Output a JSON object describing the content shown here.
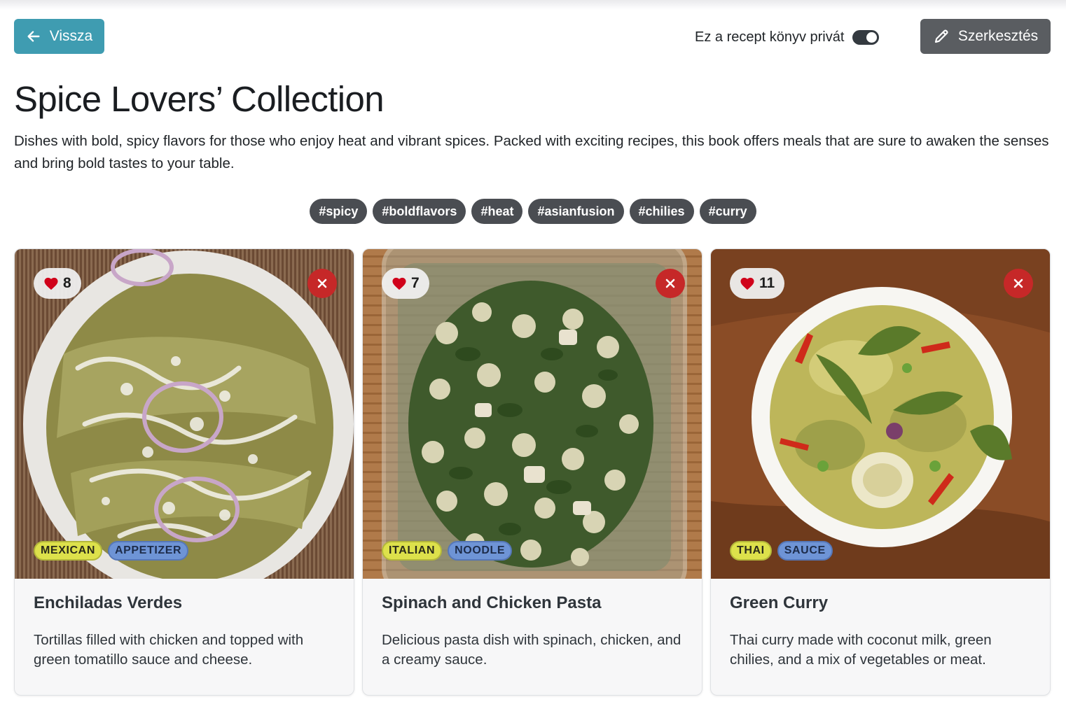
{
  "header": {
    "back_label": "Vissza",
    "privacy_label": "Ez a recept könyv privát",
    "privacy_on": true,
    "edit_label": "Szerkesztés"
  },
  "book": {
    "title": "Spice Lovers’ Collection",
    "description": "Dishes with bold, spicy flavors for those who enjoy heat and vibrant spices. Packed with exciting recipes, this book offers meals that are sure to awaken the senses and bring bold tastes to your table.",
    "tags": [
      "#spicy",
      "#boldflavors",
      "#heat",
      "#asianfusion",
      "#chilies",
      "#curry"
    ]
  },
  "recipes": [
    {
      "likes": "8",
      "title": "Enchiladas Verdes",
      "description": "Tortillas filled with chicken and topped with green tomatillo sauce and cheese.",
      "cuisine": "MEXICAN",
      "type": "APPETIZER"
    },
    {
      "likes": "7",
      "title": "Spinach and Chicken Pasta",
      "description": "Delicious pasta dish with spinach, chicken, and a creamy sauce.",
      "cuisine": "ITALIAN",
      "type": "NOODLE"
    },
    {
      "likes": "11",
      "title": "Green Curry",
      "description": "Thai curry made with coconut milk, green chilies, and a mix of vegetables or meat.",
      "cuisine": "THAI",
      "type": "SAUCE"
    }
  ],
  "colors": {
    "back_button": "#3f9cb1",
    "edit_button": "#5a5d61",
    "tag_bg": "#4a4d52",
    "cuisine_badge": "#dde14b",
    "type_badge": "#6e94d6",
    "remove_button": "#c62828",
    "heart": "#d0021b"
  }
}
